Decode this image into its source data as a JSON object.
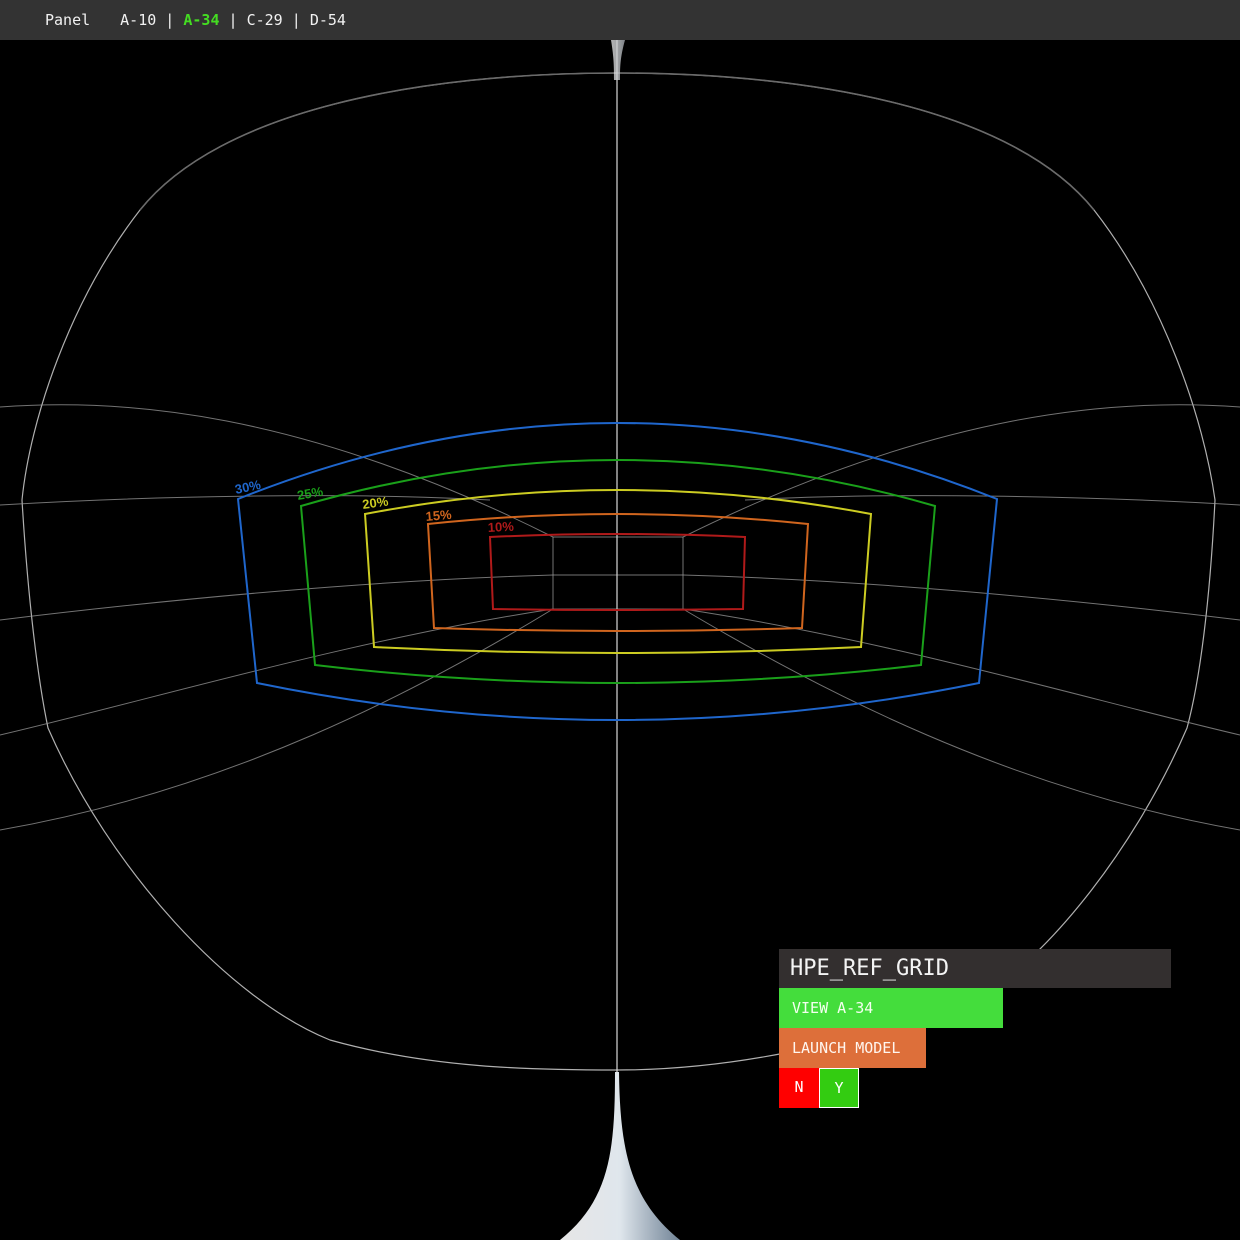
{
  "topbar": {
    "panel_label": "Panel",
    "tabs": [
      {
        "label": "A-10",
        "active": false
      },
      {
        "label": "A-34",
        "active": true
      },
      {
        "label": "C-29",
        "active": false
      },
      {
        "label": "D-54",
        "active": false
      }
    ],
    "separator": " | ",
    "active_color": "#44dd22"
  },
  "grid_labels": {
    "r30": "30%",
    "r25": "25%",
    "r20": "20%",
    "r15": "15%",
    "r10": "10%"
  },
  "colors": {
    "r30": "#1f66cc",
    "r25": "#1aa01a",
    "r20": "#cccc22",
    "r15": "#d0651e",
    "r10": "#b01a1a"
  },
  "ref_panel": {
    "title": "HPE_REF_GRID",
    "view_label": "VIEW A-34",
    "launch_label": "LAUNCH MODEL",
    "no_label": "N",
    "yes_label": "Y"
  }
}
